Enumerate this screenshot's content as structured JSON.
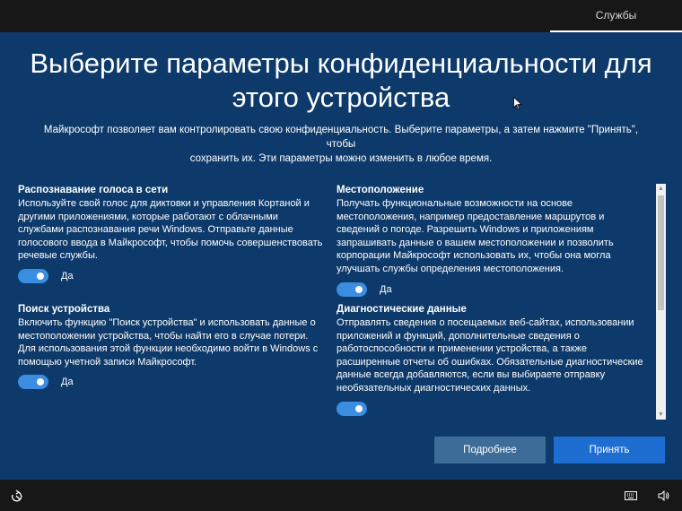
{
  "header": {
    "tab_label": "Службы"
  },
  "page": {
    "title_line1": "Выберите параметры конфиденциальности для",
    "title_line2": "этого устройства",
    "subtitle_line1": "Майкрософт позволяет вам контролировать свою конфиденциальность. Выберите параметры, а затем нажмите \"Принять\", чтобы",
    "subtitle_line2": "сохранить их. Эти параметры можно изменить в любое время."
  },
  "settings": [
    {
      "title": "Распознавание голоса в сети",
      "description": "Используйте свой голос для диктовки и управления Кортаной и другими приложениями, которые работают с облачными службами распознавания речи Windows. Отправьте данные голосового ввода в Майкрософт, чтобы помочь совершенствовать речевые службы.",
      "toggle_state": "on",
      "toggle_label": "Да"
    },
    {
      "title": "Поиск устройства",
      "description": "Включить функцию \"Поиск устройства\" и использовать данные о местоположении устройства, чтобы найти его в случае потери. Для использования этой функции необходимо войти в Windows с помощью учетной записи Майкрософт.",
      "toggle_state": "on",
      "toggle_label": "Да"
    },
    {
      "title": "Местоположение",
      "description": "Получать функциональные возможности на основе местоположения, например предоставление маршрутов и сведений о погоде. Разрешить Windows и приложениям запрашивать данные о вашем местоположении и позволить корпорации Майкрософт использовать их, чтобы она могла улучшать службы определения местоположения.",
      "toggle_state": "on",
      "toggle_label": "Да"
    },
    {
      "title": "Диагностические данные",
      "description": "Отправлять сведения о посещаемых веб-сайтах, использовании приложений и функций, дополнительные сведения о работоспособности и применении устройства, а также расширенные отчеты об ошибках. Обязательные диагностические данные всегда добавляются, если вы выбираете отправку необязательных диагностических данных.",
      "toggle_state": "on"
    }
  ],
  "buttons": {
    "more": "Подробнее",
    "accept": "Принять"
  },
  "taskbar": {
    "left_icon": "ease-of-access-icon",
    "right_icons": [
      "keyboard-icon",
      "volume-icon"
    ]
  },
  "colors": {
    "background": "#0d3a6b",
    "toggle_on": "#3a8de0",
    "accept_button": "#1e6ed2",
    "secondary_button": "#3d6c99",
    "bar": "#171717"
  }
}
